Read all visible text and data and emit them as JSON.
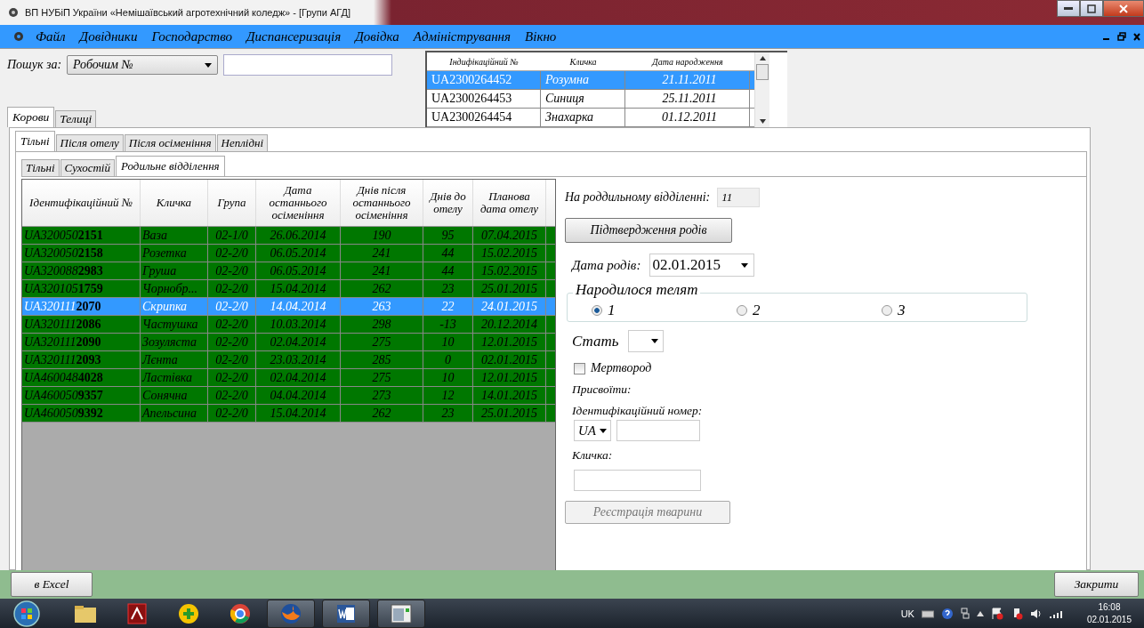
{
  "window": {
    "title": "ВП НУБіП України «Немішаївський агротехнічний коледж» - [Групи АГД]"
  },
  "menu": [
    "Файл",
    "Довідники",
    "Господарство",
    "Диспансеризація",
    "Довідка",
    "Адміністрування",
    "Вікно"
  ],
  "search": {
    "label": "Пошук за:",
    "by": "Робочим №"
  },
  "lookup": {
    "columns": [
      "Індифікаційний №",
      "Кличка",
      "Дата народження"
    ],
    "rows": [
      {
        "cells": [
          "UA2300264452",
          "Розумна",
          "21.11.2011"
        ],
        "selected": true
      },
      {
        "cells": [
          "UA2300264453",
          "Синиця",
          "25.11.2011"
        ],
        "selected": false
      },
      {
        "cells": [
          "UA2300264454",
          "Знахарка",
          "01.12.2011"
        ],
        "selected": false
      }
    ]
  },
  "outer_tabs": [
    {
      "label": "Корови",
      "selected": true
    },
    {
      "label": "Телиці",
      "selected": false
    }
  ],
  "group_tabs": [
    {
      "label": "Тільні",
      "selected": true
    },
    {
      "label": "Після отелу",
      "selected": false
    },
    {
      "label": "Після осіменіння",
      "selected": false
    },
    {
      "label": "Неплідні",
      "selected": false
    }
  ],
  "sub_tabs": [
    {
      "label": "Тільні",
      "selected": false
    },
    {
      "label": "Сухостій",
      "selected": false
    },
    {
      "label": "Родильне відділення",
      "selected": true
    }
  ],
  "grid": {
    "columns": [
      "Ідентифікаційний №",
      "Кличка",
      "Група",
      "Дата останнього осіменіння",
      "Днів після останнього осіменіння",
      "Днів до отелу",
      "Планова дата отелу"
    ],
    "rows": [
      {
        "cells": [
          "UA320050**2151**",
          "Ваза",
          "02-1/0",
          "26.06.2014",
          "190",
          "95",
          "07.04.2015"
        ],
        "selected": false
      },
      {
        "cells": [
          "UA320050**2158**",
          "Розетка",
          "02-2/0",
          "06.05.2014",
          "241",
          "44",
          "15.02.2015"
        ],
        "selected": false
      },
      {
        "cells": [
          "UA320088**2983**",
          "Груша",
          "02-2/0",
          "06.05.2014",
          "241",
          "44",
          "15.02.2015"
        ],
        "selected": false
      },
      {
        "cells": [
          "UA320105**1759**",
          "Чорнобр...",
          "02-2/0",
          "15.04.2014",
          "262",
          "23",
          "25.01.2015"
        ],
        "selected": false
      },
      {
        "cells": [
          "UA320111**2070**",
          "Скрипка",
          "02-2/0",
          "14.04.2014",
          "263",
          "22",
          "24.01.2015"
        ],
        "selected": true
      },
      {
        "cells": [
          "UA320111**2086**",
          "Частушка",
          "02-2/0",
          "10.03.2014",
          "298",
          "-13",
          "20.12.2014"
        ],
        "selected": false
      },
      {
        "cells": [
          "UA320111**2090**",
          "Зозуляста",
          "02-2/0",
          "02.04.2014",
          "275",
          "10",
          "12.01.2015"
        ],
        "selected": false
      },
      {
        "cells": [
          "UA320111**2093**",
          "Лєнта",
          "02-2/0",
          "23.03.2014",
          "285",
          "0",
          "02.01.2015"
        ],
        "selected": false
      },
      {
        "cells": [
          "UA460048**4028**",
          "Ластівка",
          "02-2/0",
          "02.04.2014",
          "275",
          "10",
          "12.01.2015"
        ],
        "selected": false
      },
      {
        "cells": [
          "UA460050**9357**",
          "Сонячна",
          "02-2/0",
          "04.04.2014",
          "273",
          "12",
          "14.01.2015"
        ],
        "selected": false
      },
      {
        "cells": [
          "UA460050**9392**",
          "Апельсина",
          "02-2/0",
          "15.04.2014",
          "262",
          "23",
          "25.01.2015"
        ],
        "selected": false
      }
    ]
  },
  "form": {
    "count_label": "На роддильному відділенні:",
    "count": "11",
    "confirm_button": {
      "label": "Підтвердження родів",
      "disabled": false
    },
    "date_label": "Дата родів:",
    "date": "02.01.2015",
    "calves": {
      "legend": "Народилося телят",
      "options": [
        {
          "label": "1",
          "selected": true
        },
        {
          "label": "2",
          "selected": false
        },
        {
          "label": "3",
          "selected": false
        }
      ]
    },
    "sex_label": "Стать",
    "stillborn": {
      "label": "Мертвород",
      "checked": false
    },
    "assign_label": "Присвоїти:",
    "id_label": "Ідентифікаційний номер:",
    "id_prefix": "UA",
    "name_label": "Кличка:",
    "register_button": {
      "label": "Реєстрація тварини",
      "disabled": true
    }
  },
  "bottom": {
    "export_button": "в Excel",
    "close_button": "Закрити"
  },
  "taskbar": {
    "language": "UK",
    "time": "16:08",
    "date": "02.01.2015"
  }
}
